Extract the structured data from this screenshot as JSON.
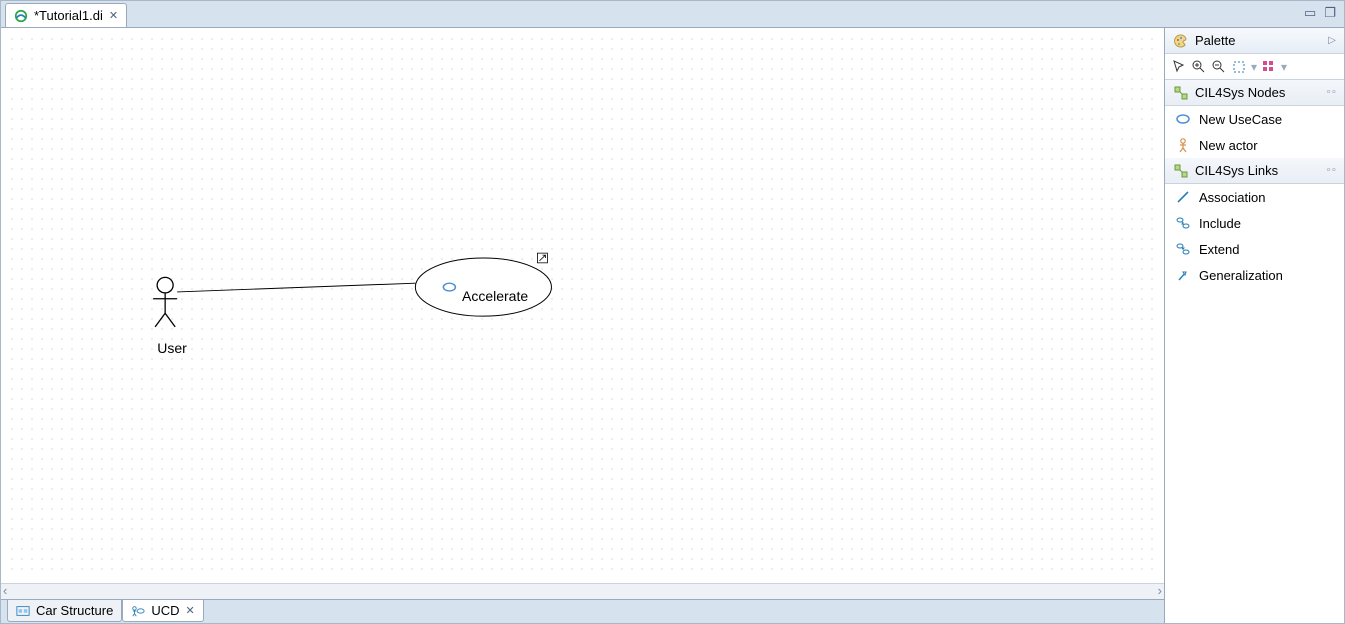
{
  "editor": {
    "tab_title": "*Tutorial1.di"
  },
  "diagram": {
    "actor": {
      "name": "User"
    },
    "usecase": {
      "name": "Accelerate"
    }
  },
  "bottom_tabs": {
    "tab1": "Car Structure",
    "tab2": "UCD"
  },
  "palette": {
    "title": "Palette",
    "section_nodes": "CIL4Sys Nodes",
    "section_links": "CIL4Sys Links",
    "items": {
      "new_usecase": "New UseCase",
      "new_actor": "New actor",
      "association": "Association",
      "include": "Include",
      "extend": "Extend",
      "generalization": "Generalization"
    }
  }
}
